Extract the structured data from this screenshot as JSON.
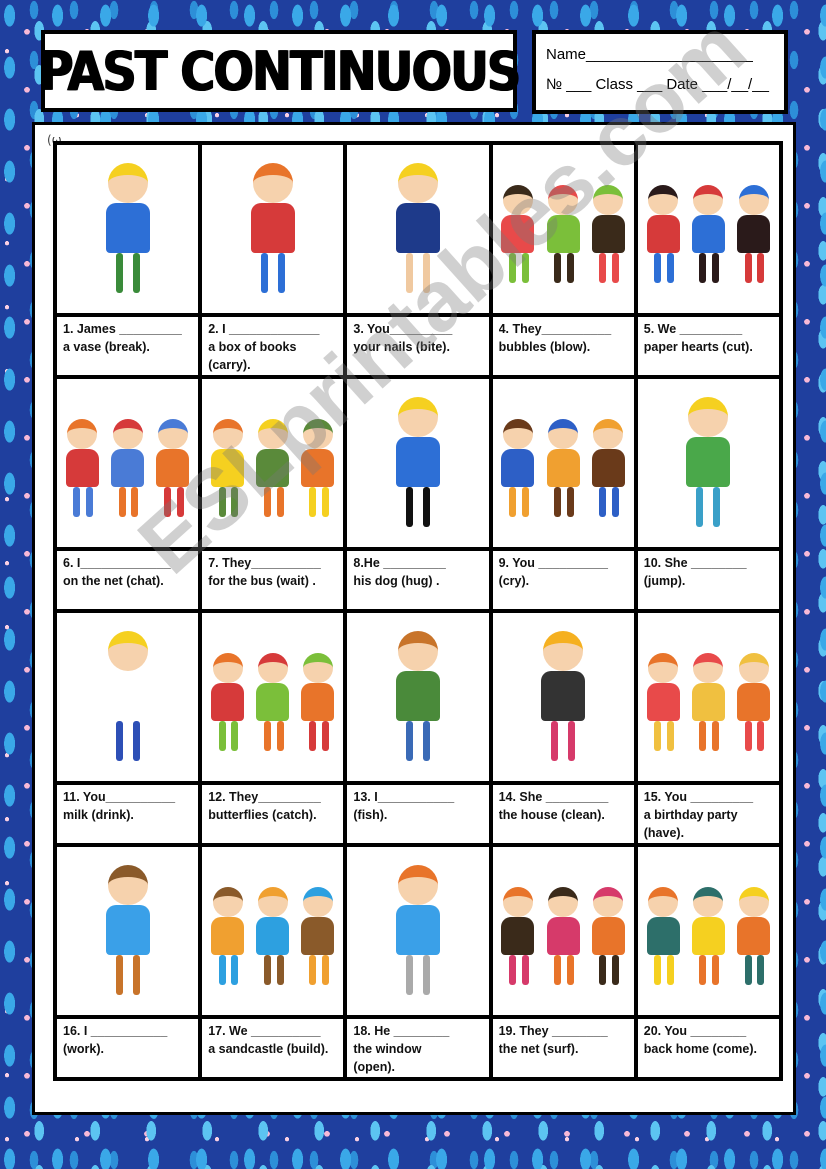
{
  "header": {
    "title": "PAST CONTINUOUS",
    "name_line": "Name____________________",
    "meta_line": "№ ___ Class ___ Date ___/__/__"
  },
  "corner_mark": "(ω",
  "watermark": "ESLprintables.com",
  "exercises": [
    {
      "num": "1",
      "line1": "1. James _________",
      "line2": "a vase (break).",
      "line3": "",
      "picture": "boy-broken-vase"
    },
    {
      "num": "2",
      "line1": "2. I _____________",
      "line2": "a box of books",
      "line3": "(carry).",
      "picture": "boy-carrying-box"
    },
    {
      "num": "3",
      "line1": "3. You_________",
      "line2": "your nails (bite).",
      "line3": "",
      "picture": "boy-biting-nails"
    },
    {
      "num": "4",
      "line1": "4. They__________",
      "line2": "bubbles (blow).",
      "line3": "",
      "picture": "kids-blowing-bubbles"
    },
    {
      "num": "5",
      "line1": "5. We _________",
      "line2": "paper hearts (cut).",
      "line3": "",
      "picture": "kids-cutting-hearts"
    },
    {
      "num": "6",
      "line1": "6. I_____________",
      "line2": "on the net (chat).",
      "line3": "",
      "picture": "kids-at-computer"
    },
    {
      "num": "7",
      "line1": "7. They__________",
      "line2": "for the bus (wait) .",
      "line3": "",
      "picture": "kids-at-bus-stop"
    },
    {
      "num": "8",
      "line1": "8.He _________",
      "line2": " his dog (hug) .",
      "line3": "",
      "picture": "boy-hugging-dog"
    },
    {
      "num": "9",
      "line1": "9. You __________",
      "line2": "(cry).",
      "line3": "",
      "picture": "kids-crying"
    },
    {
      "num": "10",
      "line1": "10. She ________",
      "line2": "(jump).",
      "line3": "",
      "picture": "girl-trampoline"
    },
    {
      "num": "11",
      "line1": "11. You__________",
      "line2": " milk (drink).",
      "line3": "",
      "picture": "boy-drinking-milk"
    },
    {
      "num": "12",
      "line1": "12. They_________",
      "line2": " butterflies (catch).",
      "line3": "",
      "picture": "kids-catching-butterflies"
    },
    {
      "num": "13",
      "line1": "13. I___________",
      "line2": "(fish).",
      "line3": "",
      "picture": "man-fishing"
    },
    {
      "num": "14",
      "line1": "14. She _________",
      "line2": "the house (clean).",
      "line3": "",
      "picture": "maid-cleaning"
    },
    {
      "num": "15",
      "line1": "15. You _________",
      "line2": "a birthday party",
      "line3": "(have).",
      "picture": "family-birthday"
    },
    {
      "num": "16",
      "line1": "16. I ___________",
      "line2": "(work).",
      "line3": "",
      "picture": "man-at-desk"
    },
    {
      "num": "17",
      "line1": "17. We __________",
      "line2": "a sandcastle (build).",
      "line3": "",
      "picture": "kids-sandcastle"
    },
    {
      "num": "18",
      "line1": "18. He ________",
      "line2": "the window",
      "line3": "(open).",
      "picture": "boy-opening-window"
    },
    {
      "num": "19",
      "line1": "19. They ________",
      "line2": "the net (surf).",
      "line3": "",
      "picture": "kids-surfing-net"
    },
    {
      "num": "20",
      "line1": "20. You ________",
      "line2": "back home (come).",
      "line3": "",
      "picture": "kids-walking-home"
    }
  ],
  "colors": {
    "border_bg": "#1f3f9e",
    "leaf_light": "#5cc4f2",
    "flower_pink": "#f7b9d7",
    "ink": "#000000"
  }
}
